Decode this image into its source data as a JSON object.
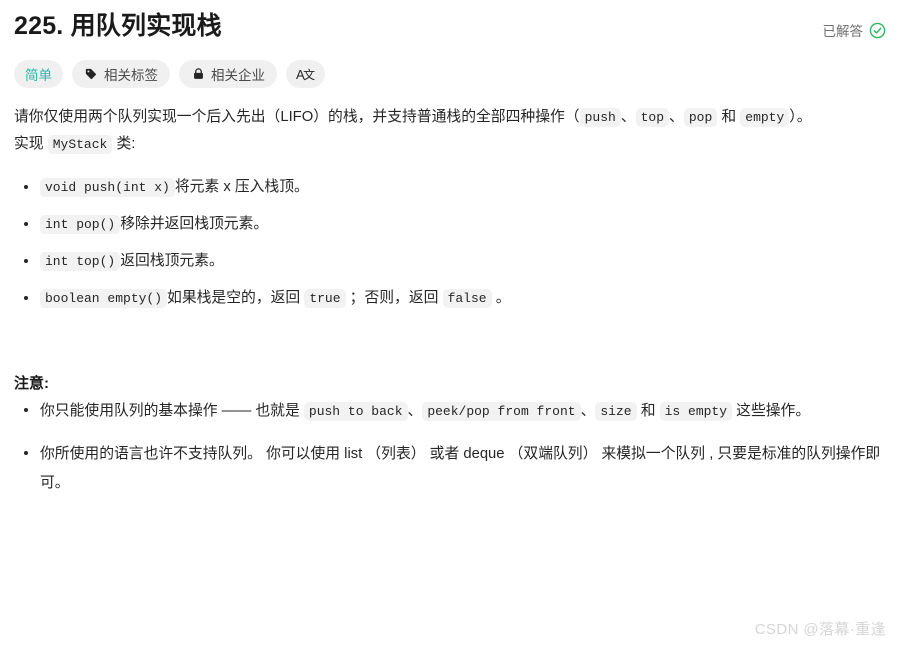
{
  "header": {
    "title": "225. 用队列实现栈",
    "status_label": "已解答",
    "status_icon": "check-circle-icon",
    "status_color": "#2db55d"
  },
  "chips": [
    {
      "label": "简单",
      "icon": null,
      "kind": "difficulty",
      "color": "#2db3a6"
    },
    {
      "label": "相关标签",
      "icon": "tag-icon",
      "kind": "tags"
    },
    {
      "label": "相关企业",
      "icon": "lock-icon",
      "kind": "companies"
    },
    {
      "label": "A文",
      "icon": "translate-icon",
      "kind": "translate"
    }
  ],
  "description": {
    "intro_parts": [
      {
        "type": "text",
        "value": "请你仅使用两个队列实现一个后入先出（LIFO）的栈，并支持普通栈的全部四种操作（"
      },
      {
        "type": "code",
        "value": "push"
      },
      {
        "type": "text",
        "value": "、"
      },
      {
        "type": "code",
        "value": "top"
      },
      {
        "type": "text",
        "value": "、"
      },
      {
        "type": "code",
        "value": "pop"
      },
      {
        "type": "text",
        "value": " 和 "
      },
      {
        "type": "code",
        "value": "empty"
      },
      {
        "type": "text",
        "value": "）。"
      }
    ],
    "implement_prefix": "实现 ",
    "implement_class": "MyStack",
    "implement_suffix": " 类:",
    "methods": [
      {
        "signature": "void push(int x)",
        "desc": "将元素 x 压入栈顶。"
      },
      {
        "signature": "int pop()",
        "desc": "移除并返回栈顶元素。"
      },
      {
        "signature": "int top()",
        "desc": "返回栈顶元素。"
      },
      {
        "signature": "boolean empty()",
        "desc_before": "如果栈是空的，返回 ",
        "code_true": "true",
        "desc_middle": " ；否则，返回 ",
        "code_false": "false",
        "desc_after": " 。"
      }
    ]
  },
  "notes": {
    "title": "注意:",
    "items": [
      {
        "lead": "你只能使用队列的基本操作 —— 也就是 ",
        "codes": [
          "push to back",
          "peek/pop from front",
          "size",
          "is empty"
        ],
        "sep1": "、",
        "sep2": "、",
        "sep3": " 和 ",
        "tail": " 这些操作。"
      },
      {
        "text": "你所使用的语言也许不支持队列。 你可以使用 list （列表） 或者 deque （双端队列） 来模拟一个队列 , 只要是标准的队列操作即可。"
      }
    ]
  },
  "watermark": {
    "text": "CSDN @落幕·重逢"
  }
}
